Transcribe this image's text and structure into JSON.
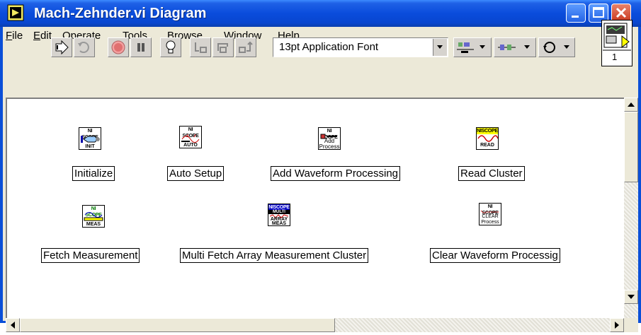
{
  "window": {
    "title": "Mach-Zehnder.vi Diagram"
  },
  "menu": [
    {
      "label": "File",
      "underline": "F",
      "rest": "ile"
    },
    {
      "label": "Edit",
      "underline": "E",
      "rest": "dit"
    },
    {
      "label": "Operate",
      "underline": "O",
      "rest": "perate"
    },
    {
      "label": "Tools",
      "underline": "T",
      "rest": "ools"
    },
    {
      "label": "Browse",
      "underline": "B",
      "rest": "rowse"
    },
    {
      "label": "Window",
      "underline": "W",
      "rest": "indow"
    },
    {
      "label": "Help",
      "underline": "H",
      "rest": "elp"
    }
  ],
  "toolbar": {
    "font_selector": "13pt Application Font",
    "buttons": [
      "run-icon",
      "run-continuously-icon",
      "abort-icon",
      "pause-icon",
      "highlight-execution-icon",
      "step-into-icon",
      "step-over-icon",
      "step-out-icon",
      "align-icon",
      "distribute-icon",
      "reorder-icon"
    ]
  },
  "context_help": {
    "number": "1"
  },
  "diagram": {
    "nodes": [
      {
        "label": "Initialize",
        "icon_header": "NI SCOPE",
        "icon_text": "INIT",
        "header_color": "#ffffff"
      },
      {
        "label": "Auto Setup",
        "icon_header": "NI SCOPE",
        "icon_text": "AUTO",
        "header_color": "#ffffff"
      },
      {
        "label": "Add Waveform Processing",
        "icon_header": "NI SCOPE",
        "icon_text": "Add Process",
        "header_color": "#ffffff"
      },
      {
        "label": "Read Cluster",
        "icon_header": "NISCOPE",
        "icon_text": "READ",
        "header_color": "#ffff00"
      },
      {
        "label": "Fetch Measurement",
        "icon_header": "NI SCOPE",
        "icon_text": "MEAS",
        "header_color": "#ffffff"
      },
      {
        "label": "Multi Fetch Array Measurement Cluster",
        "icon_header": "NISCOPE",
        "icon_text": "ARRAY MEAS",
        "icon_subheader": "MULTI",
        "header_color": "#0000c8"
      },
      {
        "label": "Clear Waveform Processig",
        "icon_header": "NI SCOPE",
        "icon_text": "CLEAR Process",
        "header_color": "#ffffff"
      }
    ]
  }
}
